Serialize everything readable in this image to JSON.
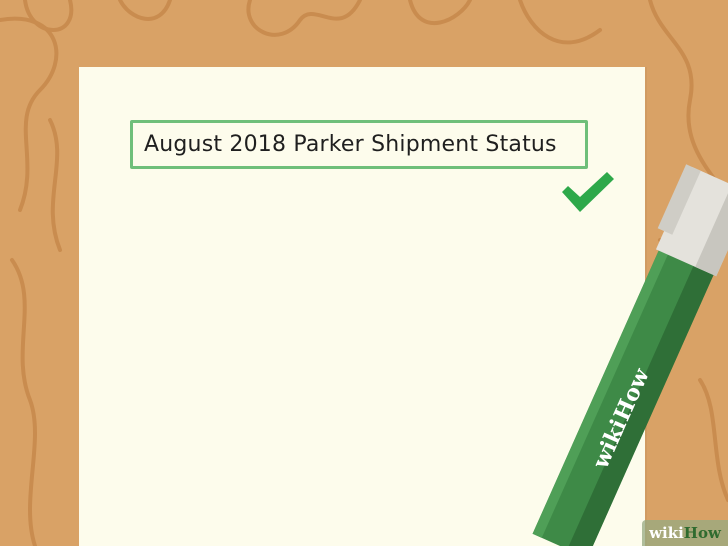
{
  "subject": {
    "text": "August 2018 Parker Shipment Status"
  },
  "pen": {
    "brand_part1": "wiki",
    "brand_part2": "How"
  },
  "watermark": {
    "part1": "wiki",
    "part2": "How"
  },
  "colors": {
    "wood": "#d9a266",
    "wood_grain": "#c98c4f",
    "paper": "#fdfcec",
    "box_border": "#6fbf7a",
    "check": "#2ea84a",
    "pen_body": "#3e8a47",
    "pen_tip": "#e4e2dc"
  },
  "icons": {
    "checkmark": "check-icon"
  }
}
